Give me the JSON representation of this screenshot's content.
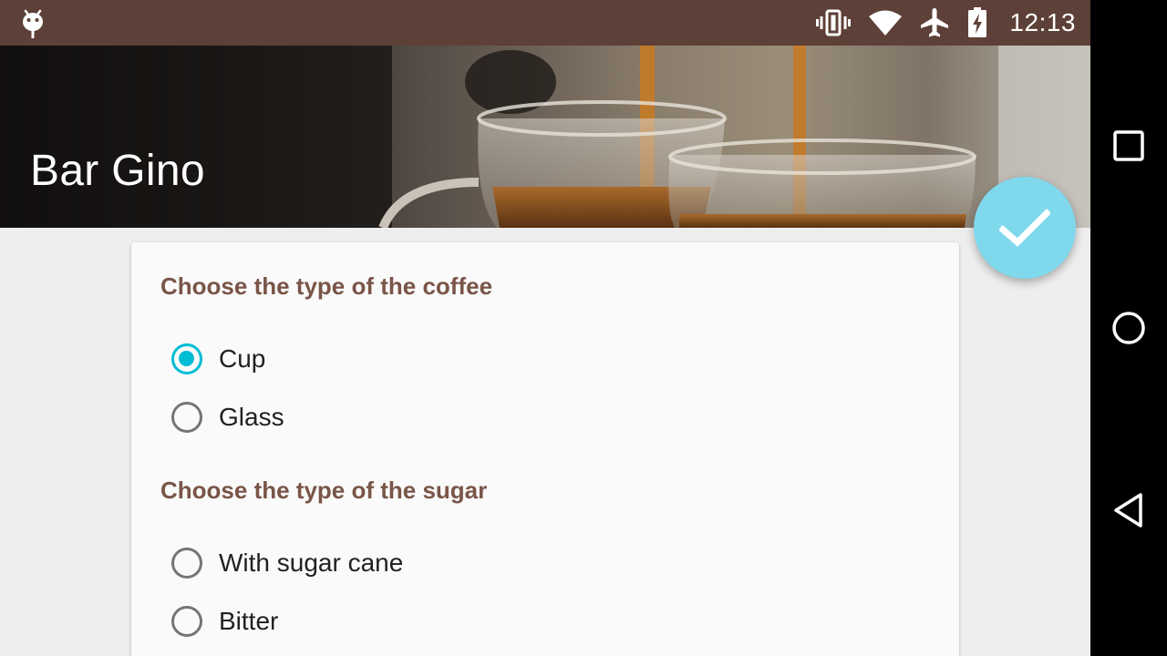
{
  "status_bar": {
    "time": "12:13",
    "icons": [
      "android-debug-icon",
      "vibrate-icon",
      "wifi-icon",
      "airplane-mode-icon",
      "battery-charging-icon"
    ]
  },
  "app": {
    "title": "Bar Gino"
  },
  "fab": {
    "icon": "check-icon",
    "color": "#80d8ec"
  },
  "form": {
    "coffee": {
      "title": "Choose the type of the coffee",
      "options": [
        {
          "label": "Cup",
          "checked": true
        },
        {
          "label": "Glass",
          "checked": false
        }
      ]
    },
    "sugar": {
      "title": "Choose the type of the sugar",
      "options": [
        {
          "label": "With sugar cane",
          "checked": false
        },
        {
          "label": "Bitter",
          "checked": false
        }
      ]
    }
  },
  "nav_bar": {
    "buttons": [
      "recents-icon",
      "home-icon",
      "back-icon"
    ]
  },
  "colors": {
    "status_bar": "#5d4037",
    "accent": "#00bcd4",
    "section_title": "#795548"
  }
}
